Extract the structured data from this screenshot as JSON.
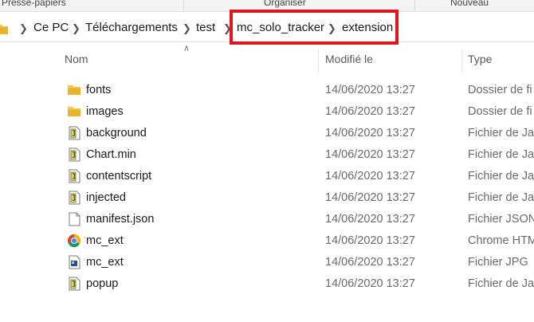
{
  "ribbon": {
    "groups": [
      "Presse-papiers",
      "Organiser",
      "Nouveau"
    ]
  },
  "breadcrumb": {
    "items": [
      "Ce PC",
      "Téléchargements",
      "test",
      "mc_solo_tracker",
      "extension"
    ]
  },
  "columns": {
    "name": "Nom",
    "modified": "Modifié le",
    "type": "Type"
  },
  "files": [
    {
      "name": "fonts",
      "modified": "14/06/2020 13:27",
      "type": "Dossier de fi",
      "icon": "folder-icon"
    },
    {
      "name": "images",
      "modified": "14/06/2020 13:27",
      "type": "Dossier de fi",
      "icon": "folder-icon"
    },
    {
      "name": "background",
      "modified": "14/06/2020 13:27",
      "type": "Fichier de Jav",
      "icon": "javascript-file-icon"
    },
    {
      "name": "Chart.min",
      "modified": "14/06/2020 13:27",
      "type": "Fichier de Jav",
      "icon": "javascript-file-icon"
    },
    {
      "name": "contentscript",
      "modified": "14/06/2020 13:27",
      "type": "Fichier de Jav",
      "icon": "javascript-file-icon"
    },
    {
      "name": "injected",
      "modified": "14/06/2020 13:27",
      "type": "Fichier de Jav",
      "icon": "javascript-file-icon"
    },
    {
      "name": "manifest.json",
      "modified": "14/06/2020 13:27",
      "type": "Fichier JSON",
      "icon": "blank-file-icon"
    },
    {
      "name": "mc_ext",
      "modified": "14/06/2020 13:27",
      "type": "Chrome HTM",
      "icon": "chrome-icon"
    },
    {
      "name": "mc_ext",
      "modified": "14/06/2020 13:27",
      "type": "Fichier JPG",
      "icon": "image-file-icon"
    },
    {
      "name": "popup",
      "modified": "14/06/2020 13:27",
      "type": "Fichier de Jav",
      "icon": "javascript-file-icon"
    }
  ],
  "colors": {
    "highlight": "#e0141e",
    "folder": "#f3c84a"
  }
}
